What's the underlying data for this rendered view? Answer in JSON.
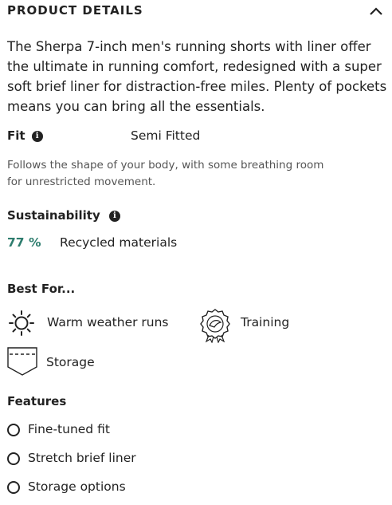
{
  "section": {
    "title": "PRODUCT DETAILS",
    "toggle_icon": "chevron-up-icon"
  },
  "description": "The Sherpa 7-inch men's running shorts with liner offer the ultimate in running comfort, redesigned with a super soft brief liner for distraction-free miles. Plenty of pockets means you can bring all the essentials.",
  "fit": {
    "label": "Fit",
    "info_icon_glyph": "i",
    "value": "Semi Fitted",
    "note": "Follows the shape of your body, with some breathing room for unrestricted movement."
  },
  "sustainability": {
    "label": "Sustainability",
    "info_icon_glyph": "i",
    "percent": "77 %",
    "material": "Recycled materials",
    "accent_color": "#2e7d6e"
  },
  "best_for": {
    "label": "Best For...",
    "items": [
      {
        "label": "Warm weather runs",
        "icon": "sun-icon"
      },
      {
        "label": "Training",
        "icon": "training-badge-icon"
      },
      {
        "label": "Storage",
        "icon": "pocket-icon"
      }
    ]
  },
  "features": {
    "label": "Features",
    "items": [
      {
        "label": "Fine-tuned fit"
      },
      {
        "label": "Stretch brief liner"
      },
      {
        "label": "Storage options"
      }
    ]
  }
}
